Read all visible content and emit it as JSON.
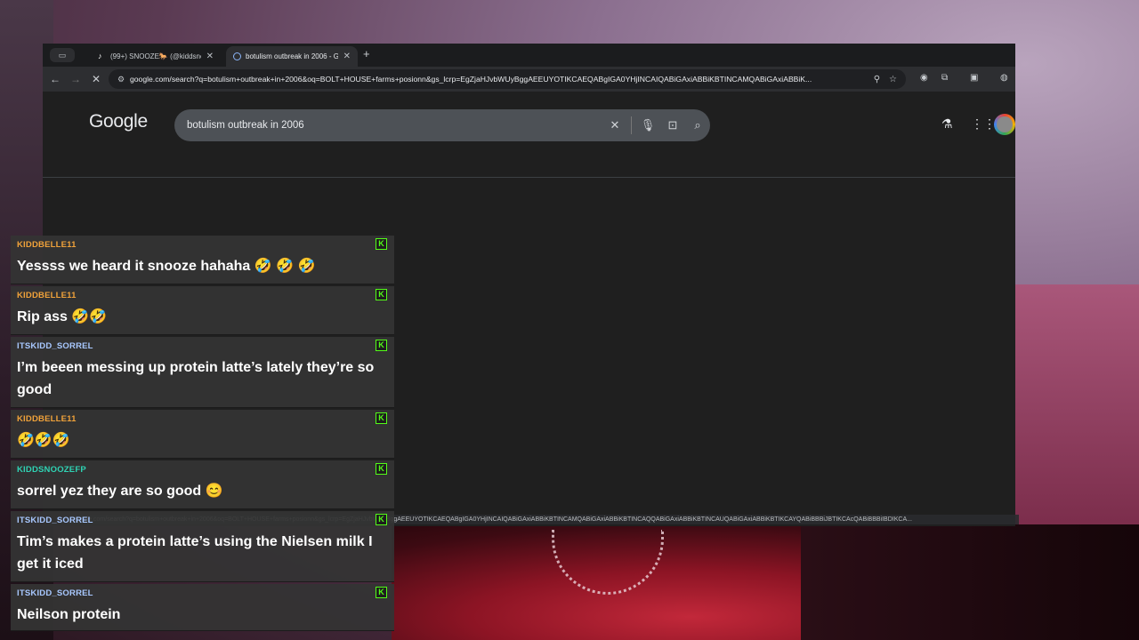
{
  "browser": {
    "tab_manager_icon": "tab-list-icon",
    "tabs": [
      {
        "label": "(99+) SNOOZE🐎 (@kiddsno",
        "active": false,
        "favicon": "tiktok-icon"
      },
      {
        "label": "botulism outbreak in 2006 - G",
        "active": true,
        "favicon": "google-icon"
      }
    ],
    "url": "google.com/search?q=botulism+outbreak+in+2006&oq=BOLT+HOUSE+farms+posionn&gs_lcrp=EgZjaHJvbWUyBggAEEUYOTIKCAEQABgIGA0YHjINCAIQABiGAxiABBiKBTINCAMQABiGAxiABBiK...",
    "status_url": "google.com/search?q=botulism+outbreak+in+2006&oq=BOLT+HOUSE+farms+posionn&gs_lcrp=EgZjaHJvbWUyBggAEEUYOTIKCAEQABgIGA0YHjINCAIQABiGAxiABBiKBTINCAMQABiGAxiABBiKBTINCAQQABiGAxiABBiKBTINCAUQABiGAxiABBiKBTIKCAYQABiBBBiJBTIKCAcQABiBBBiIBDIKCA..."
  },
  "google": {
    "logo": "Google",
    "query": "botulism outbreak in 2006"
  },
  "chat": {
    "messages": [
      {
        "user": "KIDDBELLE11",
        "text": "Yessss we heard it snooze hahaha 🤣 🤣 🤣",
        "color": "#f0a23a"
      },
      {
        "user": "KIDDBELLE11",
        "text": "Rip ass 🤣🤣",
        "color": "#f0a23a"
      },
      {
        "user": "ITSKIDD_SORREL",
        "text": "I’m beeen messing up protein latte’s lately they’re so good",
        "color": "#a8c8ff"
      },
      {
        "user": "KIDDBELLE11",
        "text": "🤣🤣🤣",
        "color": "#f0a23a"
      },
      {
        "user": "KIDDSNOOZEFP",
        "text": "sorrel yez they are so good 😊",
        "color": "#2fd3b4"
      },
      {
        "user": "ITSKIDD_SORREL",
        "text": "Tim’s makes a protein latte’s using the Nielsen milk I get it iced",
        "color": "#a8c8ff"
      },
      {
        "user": "ITSKIDD_SORREL",
        "text": "Neilson protein",
        "color": "#a8c8ff"
      }
    ]
  },
  "colors": {
    "kick_green": "#53fc18",
    "browser_bg": "#202124"
  }
}
